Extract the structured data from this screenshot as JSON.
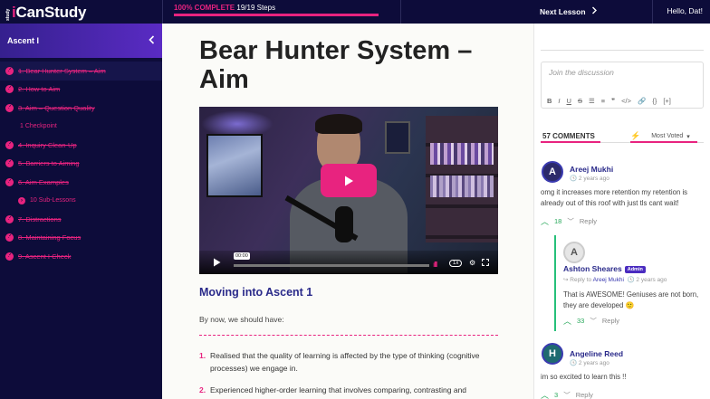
{
  "topbar": {
    "logo_small": "study",
    "logo_main": "iCanStudy",
    "progress_pct": "100% COMPLETE",
    "progress_steps": "19/19 Steps",
    "progress_fraction": 1.0,
    "next_lesson": "Next Lesson",
    "greeting": "Hello, Dat!"
  },
  "sidebar": {
    "heading": "Ascent I",
    "items": [
      {
        "label": "1. Bear Hunter System – Aim"
      },
      {
        "label": "2. How to Aim"
      },
      {
        "label": "3. Aim – Question Quality"
      },
      {
        "label": "1 Checkpoint"
      },
      {
        "label": "4. Inquiry Clean-Up"
      },
      {
        "label": "5. Barriers to Aiming"
      },
      {
        "label": "6. Aim Examples"
      },
      {
        "label": "10 Sub-Lessons"
      },
      {
        "label": "7. Distractions"
      },
      {
        "label": "8. Maintaining Focus"
      },
      {
        "label": "9. Ascent I Check"
      }
    ]
  },
  "main": {
    "title": "Bear Hunter System – Aim",
    "video": {
      "time": "00:00",
      "speed": "1x"
    },
    "section_heading": "Moving into Ascent 1",
    "intro": "By now, we should have:",
    "list": [
      {
        "num": "1.",
        "text": "Realised that the quality of learning is affected by the type of thinking (cognitive processes) we engage in."
      },
      {
        "num": "2.",
        "text": "Experienced higher-order learning that involves comparing, contrasting and"
      }
    ]
  },
  "comments": {
    "placeholder": "Join the discussion",
    "count_label": "57 COMMENTS",
    "sort_label": "Most Voted",
    "items": [
      {
        "name": "Areej Mukhi",
        "time": "2 years ago",
        "body": "omg it increases more retention my retention is already out of this roof with just tls cant wait!",
        "votes": "18",
        "reply": "Reply",
        "initial": "A"
      },
      {
        "name": "Ashton Sheares",
        "badge": "Admin",
        "reply_prefix": "Reply to",
        "reply_to": "Areej Mukhi",
        "time": "2 years ago",
        "body": "That is AWESOME! Geniuses are not born, they are developed 🙂",
        "votes": "33",
        "reply": "Reply",
        "initial": "A"
      },
      {
        "name": "Angeline Reed",
        "time": "2 years ago",
        "body": "im so excited to learn this !!",
        "votes": "3",
        "reply": "Reply",
        "initial": "H"
      }
    ]
  },
  "colors": {
    "accent": "#e8237f",
    "navy": "#0d0c3a",
    "purple": "#4a2cc0",
    "green": "#27a85a"
  }
}
